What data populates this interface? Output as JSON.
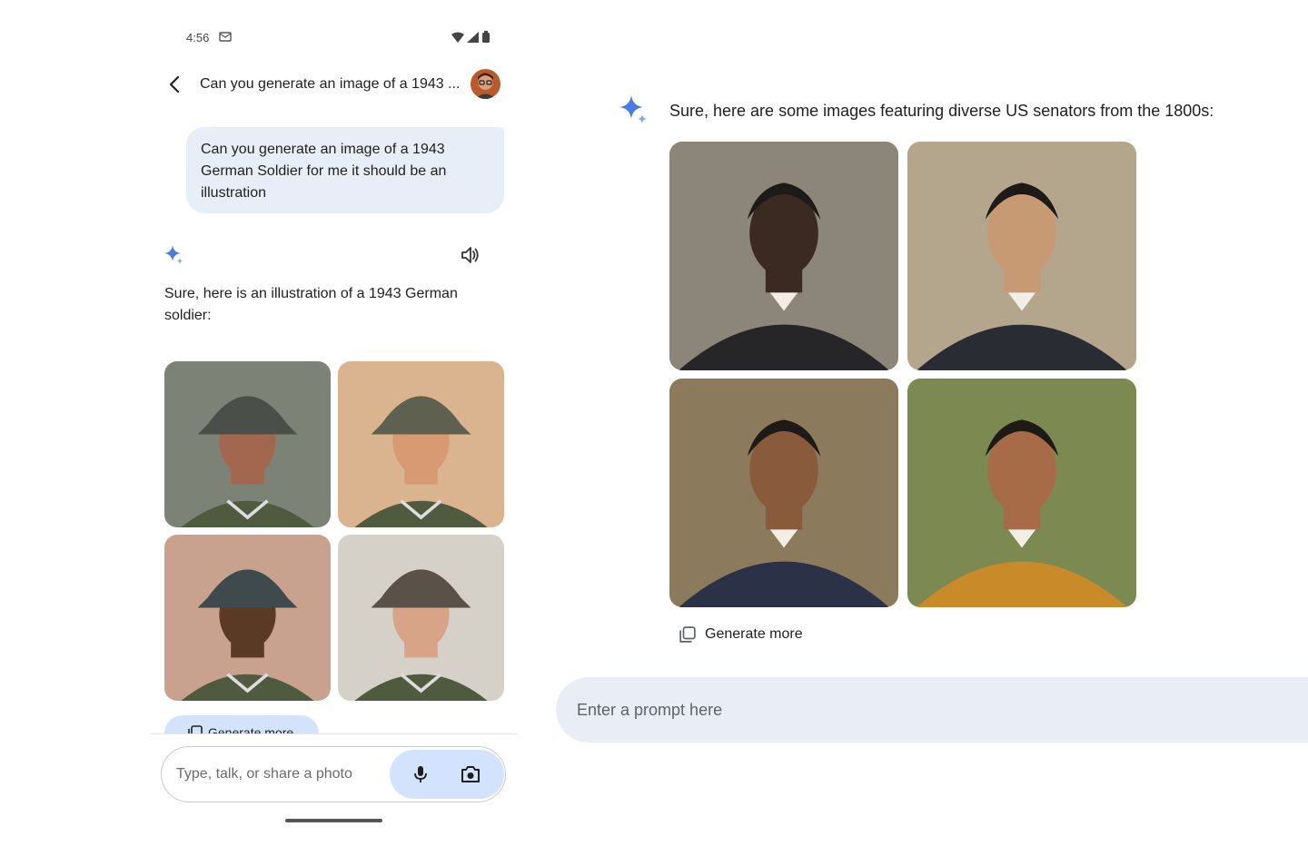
{
  "phone": {
    "status_bar": {
      "time": "4:56"
    },
    "header": {
      "title": "Can you generate an image of a 1943 ..."
    },
    "user_message": {
      "line1": "Can you generate an image of a 1943",
      "line2": "German Soldier for me it should be an",
      "line3": "illustration"
    },
    "reply": {
      "line1": "Sure, here is an illustration of a 1943 German",
      "line2": "soldier:"
    },
    "generated_images": [
      {
        "name": "soldier-image-1",
        "tone": "#a3674f",
        "bg": "#7d8277",
        "helmet": "#4a4f4a"
      },
      {
        "name": "soldier-image-2",
        "tone": "#d89a72",
        "bg": "#d9b48e",
        "helmet": "#5f6150"
      },
      {
        "name": "soldier-image-3",
        "tone": "#5b3a25",
        "bg": "#c9a28f",
        "helmet": "#3e4a4c"
      },
      {
        "name": "soldier-image-4",
        "tone": "#d8a488",
        "bg": "#d5d0c8",
        "helmet": "#5a5148"
      }
    ],
    "generate_more_label": "Generate more",
    "input": {
      "placeholder": "Type, talk, or share a photo"
    }
  },
  "desktop": {
    "reply": "Sure, here are some images featuring diverse US senators from the 1800s:",
    "generated_images": [
      {
        "name": "senator-image-1",
        "tone": "#3b2a22",
        "bg": "#8b857a",
        "cloth": "#262628"
      },
      {
        "name": "senator-image-2",
        "tone": "#c79a74",
        "bg": "#b3a68c",
        "cloth": "#2a2c33"
      },
      {
        "name": "senator-image-3",
        "tone": "#8a5a3c",
        "bg": "#8c7a5c",
        "cloth": "#2b3248"
      },
      {
        "name": "senator-image-4",
        "tone": "#a86b48",
        "bg": "#7c8a52",
        "cloth": "#c98a2a"
      }
    ],
    "generate_more_label": "Generate more",
    "input": {
      "placeholder": "Enter a prompt here"
    }
  },
  "colors": {
    "accent_blue": "#4a7be0",
    "user_bubble": "#e8eef8",
    "chip": "#d3e3fd",
    "desktop_input": "#e9eef6"
  }
}
